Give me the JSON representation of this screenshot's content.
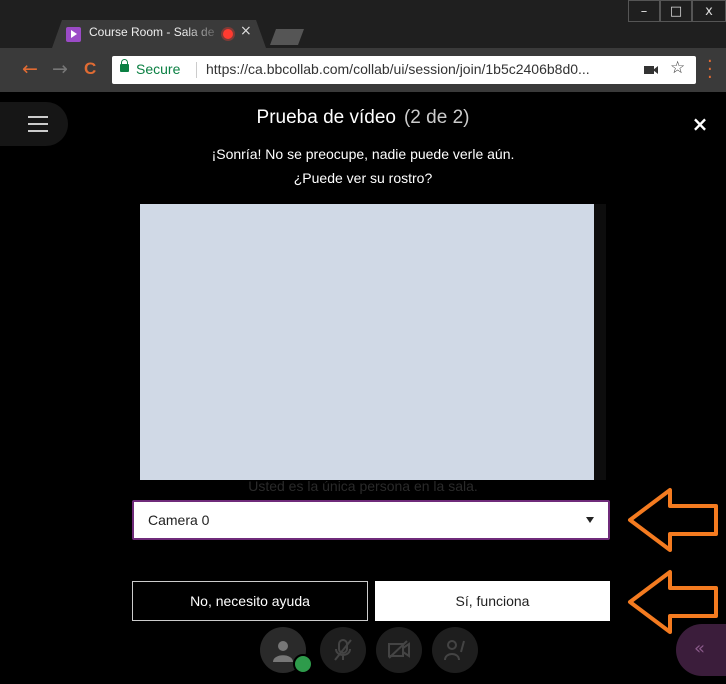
{
  "browser": {
    "tab_title": "Course Room - Sala de",
    "tab_close": "×",
    "window_controls": {
      "minimize": "–",
      "maximize": "□",
      "close": "x"
    },
    "nav": {
      "back": "←",
      "forward": "→",
      "reload": "C"
    },
    "security_label": "Secure",
    "url": "https://ca.bbcollab.com/collab/ui/session/join/1b5c2406b8d0...",
    "bookmark_star": "☆"
  },
  "dialog": {
    "title": "Prueba de vídeo",
    "step": "(2 de 2)",
    "close": "×",
    "subtitle_line1": "¡Sonría! No se preocupe, nadie puede verle aún.",
    "subtitle_line2": "¿Puede ver su rostro?",
    "underlay_text": "Usted es la única persona en la sala.",
    "camera_select_value": "Camera 0",
    "no_button": "No, necesito ayuda",
    "yes_button": "Sí, funciona"
  },
  "colors": {
    "accent_orange": "#f47b20",
    "select_border": "#6f2b7a",
    "video_preview": "#d0d9e6"
  },
  "icons": [
    "menu-icon",
    "close-icon",
    "avatar-icon",
    "mic-off-icon",
    "camera-off-icon",
    "raise-hand-icon",
    "collapse-icon"
  ]
}
